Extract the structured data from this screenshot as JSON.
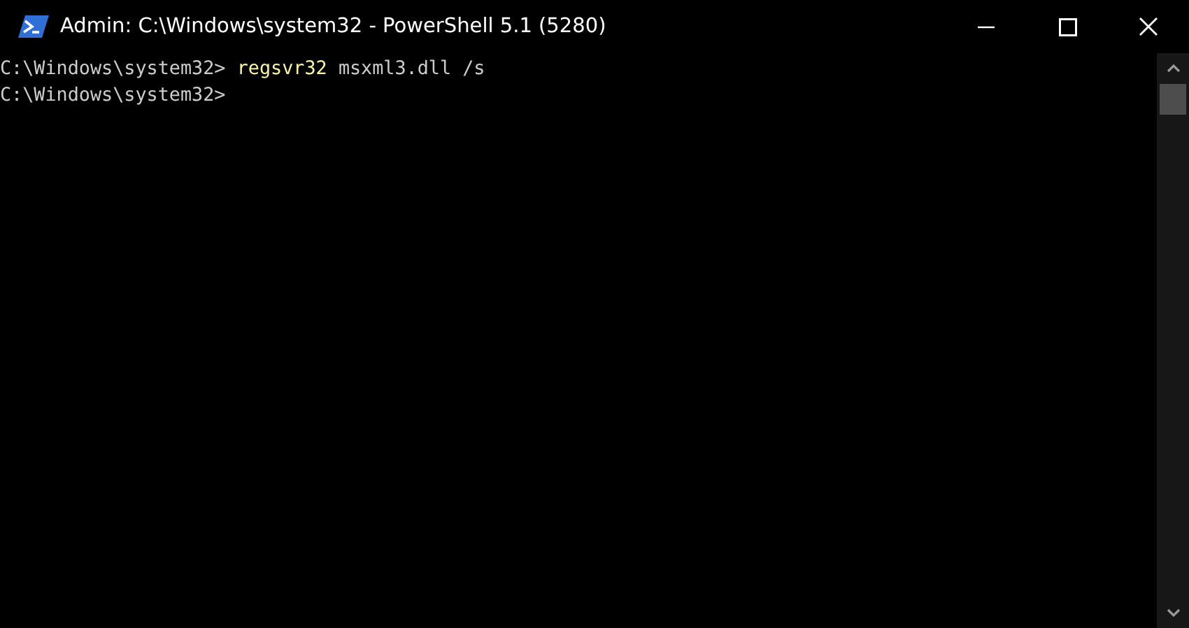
{
  "window": {
    "title": "Admin: C:\\Windows\\system32 - PowerShell 5.1 (5280)"
  },
  "console": {
    "lines": [
      {
        "segments": [
          {
            "kind": "prompt",
            "text": "C:\\Windows\\system32>"
          },
          {
            "kind": "command",
            "text": "regsvr32"
          },
          {
            "kind": "argument",
            "text": "msxml3.dll /s"
          }
        ]
      },
      {
        "segments": [
          {
            "kind": "prompt",
            "text": "C:\\Windows\\system32>"
          }
        ]
      }
    ]
  }
}
